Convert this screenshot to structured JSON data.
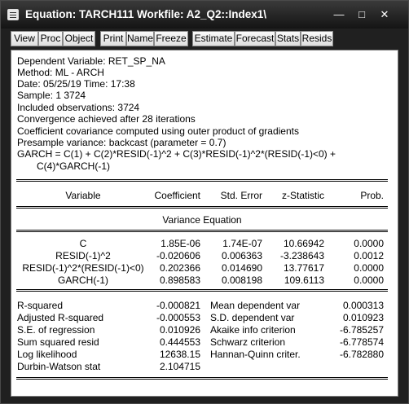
{
  "window": {
    "title": "Equation: TARCH111   Workfile: A2_Q2::Index1\\",
    "minimize_glyph": "—",
    "maximize_glyph": "□",
    "close_glyph": "✕"
  },
  "toolbar": [
    "View",
    "Proc",
    "Object",
    "Print",
    "Name",
    "Freeze",
    "Estimate",
    "Forecast",
    "Stats",
    "Resids"
  ],
  "header_lines": [
    "Dependent Variable: RET_SP_NA",
    "Method: ML - ARCH",
    "Date: 05/25/19   Time: 17:38",
    "Sample: 1 3724",
    "Included observations: 3724",
    "Convergence achieved after 28 iterations",
    "Coefficient covariance computed using outer product of gradients",
    "Presample variance: backcast (parameter = 0.7)",
    "GARCH = C(1) + C(2)*RESID(-1)^2 + C(3)*RESID(-1)^2*(RESID(-1)<0) +",
    "C(4)*GARCH(-1)"
  ],
  "table": {
    "columns": [
      "Variable",
      "Coefficient",
      "Std. Error",
      "z-Statistic",
      "Prob."
    ],
    "section": "Variance Equation",
    "rows": [
      [
        "C",
        "1.85E-06",
        "1.74E-07",
        "10.66942",
        "0.0000"
      ],
      [
        "RESID(-1)^2",
        "-0.020606",
        "0.006363",
        "-3.238643",
        "0.0012"
      ],
      [
        "RESID(-1)^2*(RESID(-1)<0)",
        "0.202366",
        "0.014690",
        "13.77617",
        "0.0000"
      ],
      [
        "GARCH(-1)",
        "0.898583",
        "0.008198",
        "109.6113",
        "0.0000"
      ]
    ]
  },
  "stats": [
    [
      "R-squared",
      "-0.000821",
      "Mean dependent var",
      "0.000313"
    ],
    [
      "Adjusted R-squared",
      "-0.000553",
      "S.D. dependent var",
      "0.010923"
    ],
    [
      "S.E. of regression",
      "0.010926",
      "Akaike info criterion",
      "-6.785257"
    ],
    [
      "Sum squared resid",
      "0.444553",
      "Schwarz criterion",
      "-6.778574"
    ],
    [
      "Log likelihood",
      "12638.15",
      "Hannan-Quinn criter.",
      "-6.782880"
    ],
    [
      "Durbin-Watson stat",
      "2.104715",
      "",
      ""
    ]
  ]
}
